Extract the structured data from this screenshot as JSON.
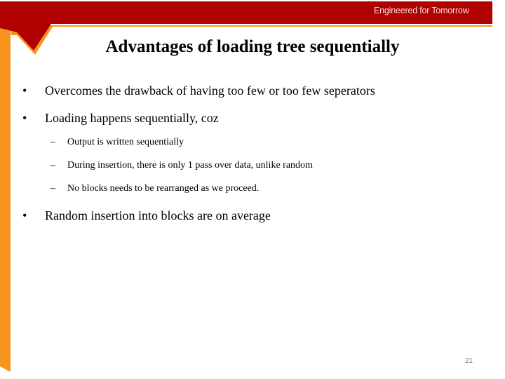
{
  "header": {
    "brand_tagline": "Engineered for Tomorrow",
    "colors": {
      "bar": "#b00000",
      "accent": "#f7941d"
    }
  },
  "slide": {
    "title": "Advantages of loading tree sequentially",
    "bullets": [
      {
        "marker": "•",
        "text": "Overcomes the drawback of having too few or too few seperators"
      },
      {
        "marker": "•",
        "text": "Loading happens sequentially, coz",
        "sub": [
          {
            "marker": "–",
            "text": "Output is written sequentially"
          },
          {
            "marker": "–",
            "text": "During insertion, there is only 1 pass over data, unlike random"
          },
          {
            "marker": "–",
            "text": "No blocks needs to be rearranged as we proceed."
          }
        ]
      },
      {
        "marker": "•",
        "text": "Random insertion into blocks are on average"
      }
    ],
    "page_number": "21"
  }
}
